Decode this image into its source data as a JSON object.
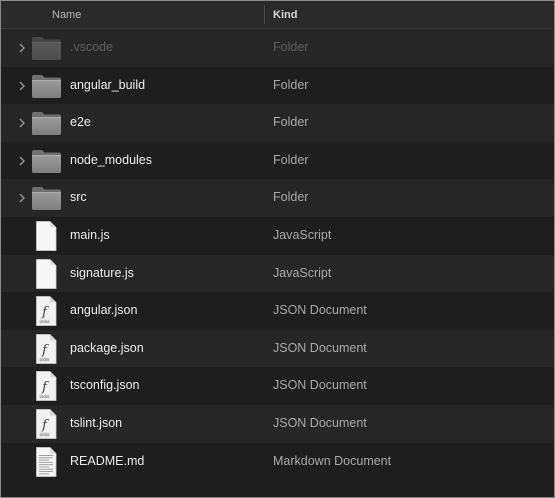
{
  "header": {
    "name_label": "Name",
    "kind_label": "Kind"
  },
  "files": [
    {
      "name": ".vscode",
      "kind": "Folder",
      "icon": "folder-icon",
      "expandable": true,
      "dimmed": true
    },
    {
      "name": "angular_build",
      "kind": "Folder",
      "icon": "folder-icon",
      "expandable": true,
      "dimmed": false
    },
    {
      "name": "e2e",
      "kind": "Folder",
      "icon": "folder-icon",
      "expandable": true,
      "dimmed": false
    },
    {
      "name": "node_modules",
      "kind": "Folder",
      "icon": "folder-icon",
      "expandable": true,
      "dimmed": false
    },
    {
      "name": "src",
      "kind": "Folder",
      "icon": "folder-icon",
      "expandable": true,
      "dimmed": false
    },
    {
      "name": "main.js",
      "kind": "JavaScript",
      "icon": "blank-document-icon",
      "expandable": false,
      "dimmed": false
    },
    {
      "name": "signature.js",
      "kind": "JavaScript",
      "icon": "blank-document-icon",
      "expandable": false,
      "dimmed": false
    },
    {
      "name": "angular.json",
      "kind": "JSON Document",
      "icon": "json-document-icon",
      "expandable": false,
      "dimmed": false
    },
    {
      "name": "package.json",
      "kind": "JSON Document",
      "icon": "json-document-icon",
      "expandable": false,
      "dimmed": false
    },
    {
      "name": "tsconfig.json",
      "kind": "JSON Document",
      "icon": "json-document-icon",
      "expandable": false,
      "dimmed": false
    },
    {
      "name": "tslint.json",
      "kind": "JSON Document",
      "icon": "json-document-icon",
      "expandable": false,
      "dimmed": false
    },
    {
      "name": "README.md",
      "kind": "Markdown Document",
      "icon": "text-document-icon",
      "expandable": false,
      "dimmed": false
    }
  ],
  "icon_text": {
    "json_badge": "JSON"
  },
  "colors": {
    "background": "#1e1e1e",
    "alternate_row": "#262626",
    "header": "#2a2a2a",
    "folder": "#8d8d8d",
    "text": "#ececec",
    "secondary_text": "#a8a8a8"
  }
}
